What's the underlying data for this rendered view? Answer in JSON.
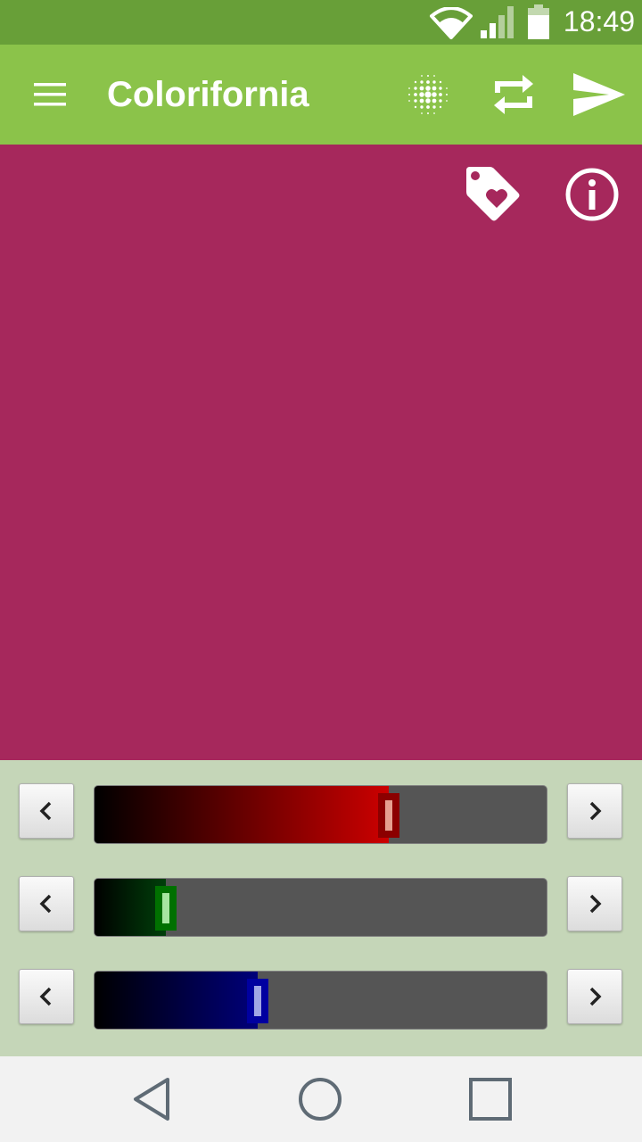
{
  "status_bar": {
    "time": "18:49",
    "icons": [
      "wifi-icon",
      "signal-icon",
      "battery-icon"
    ],
    "background": "#689f38"
  },
  "app_bar": {
    "title": "Colorifornia",
    "background": "#8bc34a",
    "icons": [
      "menu-icon",
      "dot-grid-icon",
      "repeat-icon",
      "send-icon"
    ]
  },
  "color_preview": {
    "color": "#a6285c",
    "icons": [
      "favorite-tag-icon",
      "info-icon"
    ]
  },
  "sliders": [
    {
      "channel": "red",
      "value": 166,
      "max": 255,
      "fill_from": "#000000",
      "fill_to": "#cc0000",
      "thumb_border": "#8b0000",
      "thumb_inner": "#e6a090"
    },
    {
      "channel": "green",
      "value": 40,
      "max": 255,
      "fill_from": "#000000",
      "fill_to": "#003f0a",
      "thumb_border": "#007000",
      "thumb_inner": "#a6e6a0"
    },
    {
      "channel": "blue",
      "value": 92,
      "max": 255,
      "fill_from": "#000000",
      "fill_to": "#00007a",
      "thumb_border": "#0000a0",
      "thumb_inner": "#a0a6e6"
    }
  ],
  "nav_bar": {
    "buttons": [
      "back-icon",
      "home-icon",
      "recents-icon"
    ]
  }
}
